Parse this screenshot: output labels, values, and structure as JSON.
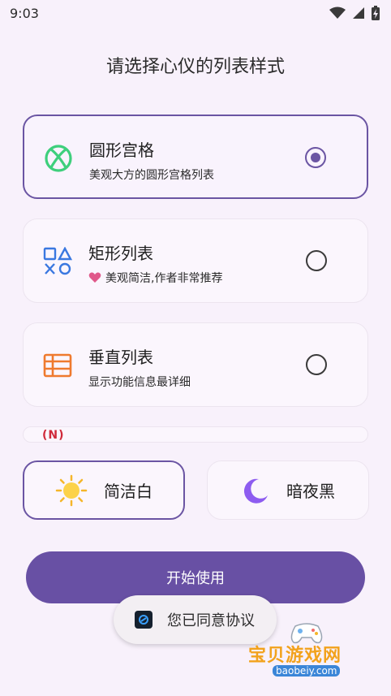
{
  "status_bar": {
    "time": "9:03"
  },
  "title": "请选择心仪的列表样式",
  "options": [
    {
      "title": "圆形宫格",
      "subtitle": "美观大方的圆形宫格列表",
      "selected": true
    },
    {
      "title": "矩形列表",
      "subtitle": "美观简洁,作者非常推荐",
      "selected": false
    },
    {
      "title": "垂直列表",
      "subtitle": "显示功能信息最详细",
      "selected": false
    }
  ],
  "partial_badge": "(N)",
  "themes": [
    {
      "label": "简洁白",
      "icon": "sun-icon",
      "selected": true
    },
    {
      "label": "暗夜黑",
      "icon": "moon-icon",
      "selected": false
    }
  ],
  "start_button": "开始使用",
  "toast": "您已同意协议",
  "watermark": {
    "title": "宝贝游戏网",
    "url": "baobeiy.com"
  },
  "colors": {
    "accent": "#6850a4",
    "background": "#f8f1fb",
    "green_icon": "#3ecf7c",
    "blue_icon": "#3a78e0",
    "orange_icon": "#ef7a2e"
  }
}
